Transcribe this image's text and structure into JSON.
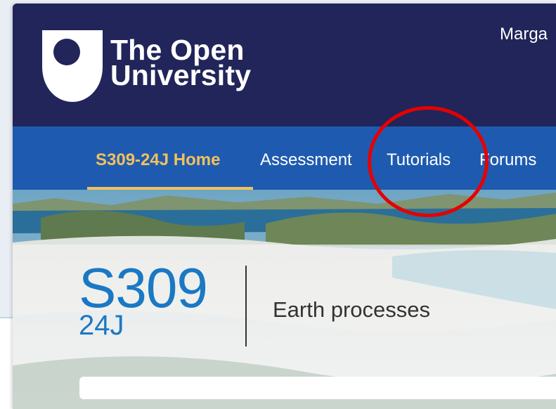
{
  "header": {
    "logo_line1": "The Open",
    "logo_line2": "University",
    "user_name": "Marga"
  },
  "nav": {
    "items": [
      {
        "label": "S309-24J Home",
        "active": true
      },
      {
        "label": "Assessment",
        "active": false
      },
      {
        "label": "Tutorials",
        "active": false
      },
      {
        "label": "Forums",
        "active": false
      }
    ]
  },
  "course": {
    "code": "S309",
    "presentation": "24J",
    "title": "Earth processes"
  },
  "colors": {
    "header_bg": "#21255a",
    "nav_bg": "#1e5bb0",
    "active_nav": "#f2c15c",
    "course_code": "#1b78c4",
    "highlight": "#e60000"
  }
}
